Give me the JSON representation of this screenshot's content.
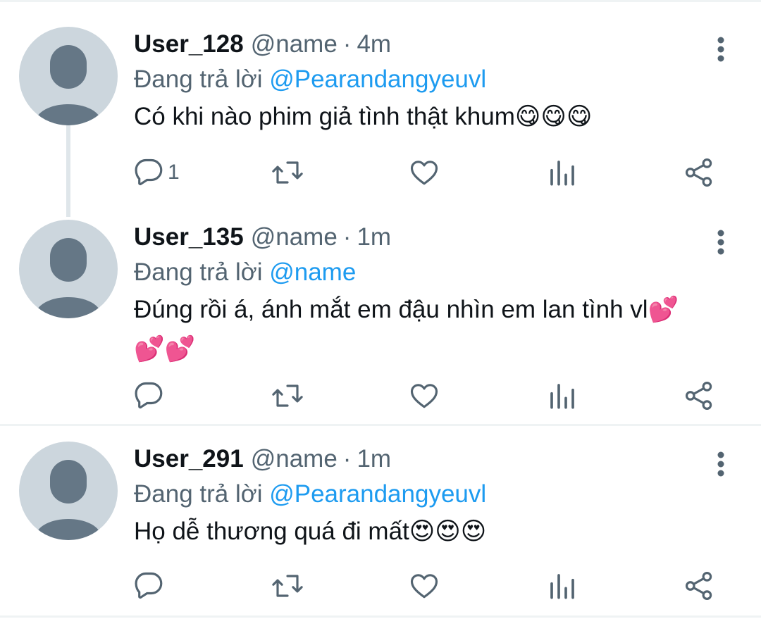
{
  "tweets": [
    {
      "username": "User_128",
      "handle": "@name",
      "separator": "·",
      "time": "4m",
      "replying_prefix": "Đang trả lời",
      "replying_to": "@Pearandangyeuvl",
      "text": "Có khi nào phim giả tình thật khum",
      "emoji": "😋😋😋",
      "reply_count": "1"
    },
    {
      "username": "User_135",
      "handle": "@name",
      "separator": "·",
      "time": "1m",
      "replying_prefix": "Đang trả lời",
      "replying_to": "@name",
      "text": "Đúng rồi á, ánh mắt em đậu nhìn em lan tình vl",
      "emoji": "💕💕💕",
      "reply_count": ""
    },
    {
      "username": "User_291",
      "handle": "@name",
      "separator": "·",
      "time": "1m",
      "replying_prefix": "Đang trả lời",
      "replying_to": "@Pearandangyeuvl",
      "text": "Họ dễ thương quá đi mất",
      "emoji": "😍😍😍",
      "reply_count": ""
    }
  ],
  "icons": {
    "more": "more-vertical-icon",
    "reply": "reply-icon",
    "retweet": "retweet-icon",
    "like": "heart-icon",
    "views": "views-icon",
    "share": "share-icon"
  },
  "colors": {
    "text": "#0f1419",
    "secondary": "#536471",
    "mention": "#1d9bf0",
    "avatar_bg": "#ccd6dd",
    "avatar_figure": "#657786",
    "thread_line": "#dfe6ea"
  }
}
